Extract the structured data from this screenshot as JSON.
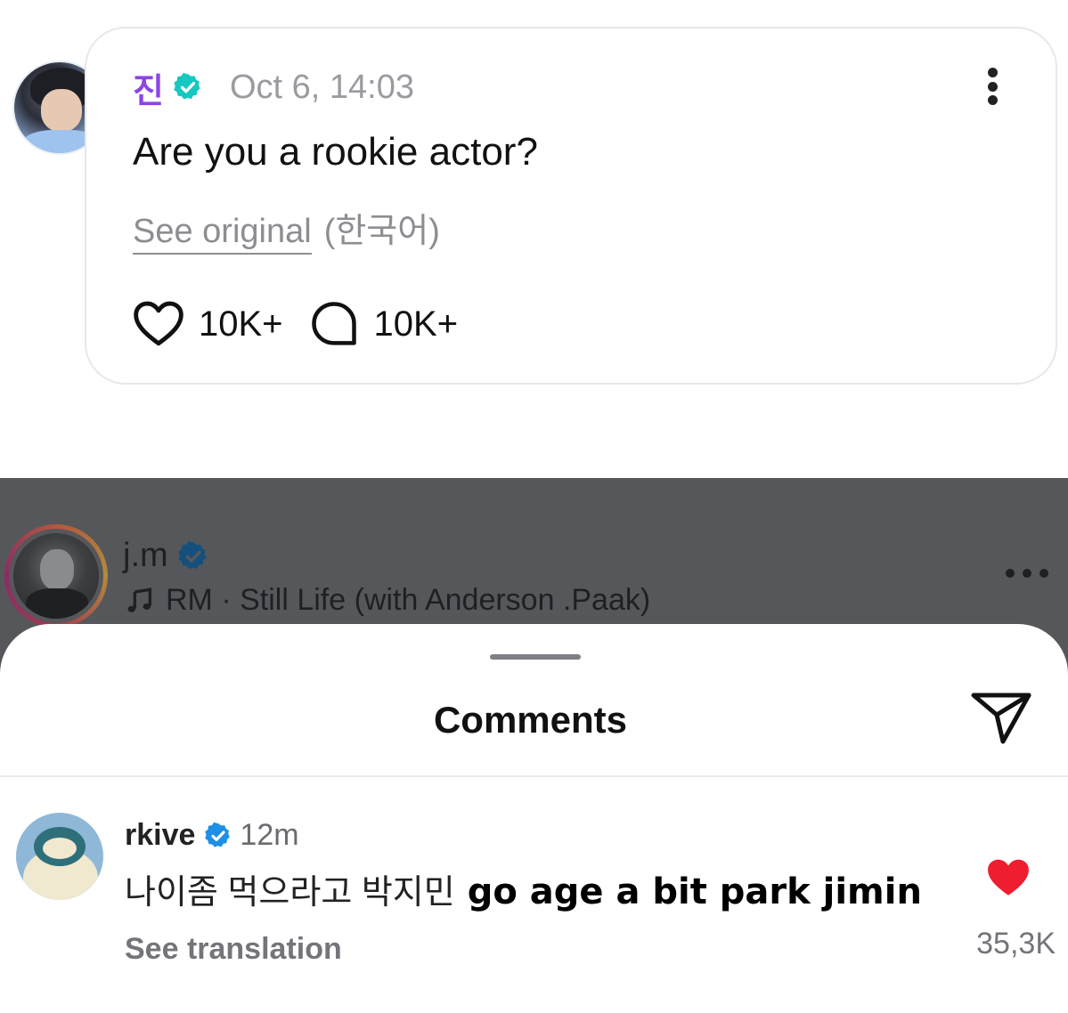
{
  "post": {
    "author": "진",
    "timestamp": "Oct 6, 14:03",
    "text": "Are you a rookie actor?",
    "see_original": "See original",
    "original_language": "(한국어)",
    "likes": "10K+",
    "comments": "10K+",
    "colors": {
      "author": "#8b45e6",
      "verified_badge": "#16c8c0"
    },
    "icons": [
      "verified-badge-icon",
      "more-vertical-icon",
      "heart-outline-icon",
      "comment-bubble-icon"
    ]
  },
  "instagram": {
    "username": "j.m",
    "music": "RM · Still Life (with Anderson .Paak)",
    "icons": [
      "verified-badge-icon",
      "music-note-icon",
      "more-horizontal-icon"
    ],
    "sheet": {
      "title": "Comments",
      "icons": [
        "share-send-icon"
      ]
    },
    "comment": {
      "user": "rkive",
      "time": "12m",
      "text_korean": "나이좀 먹으라고 박지민",
      "text_english": "go age a bit park jimin",
      "see_translation": "See translation",
      "likes": "35,3K",
      "liked": true,
      "colors": {
        "heart": "#ee1d2f",
        "verified_badge": "#1d8fe6"
      }
    }
  }
}
